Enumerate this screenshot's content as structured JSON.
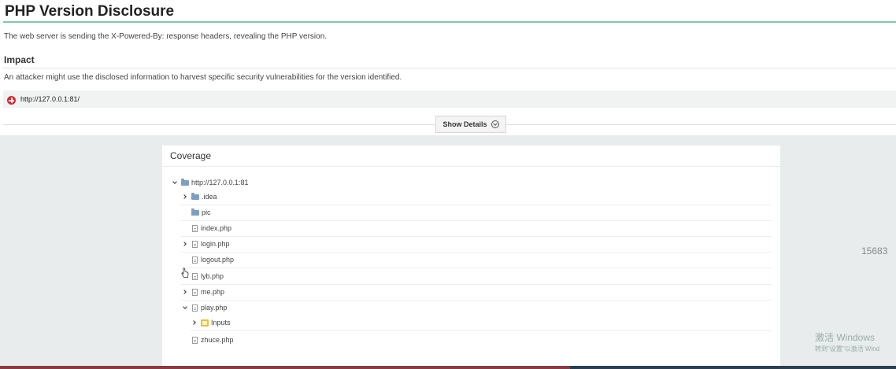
{
  "header": {
    "title": "PHP Version Disclosure",
    "description": "The web server is sending the X-Powered-By: response headers, revealing the PHP version."
  },
  "impact": {
    "heading": "Impact",
    "text": "An attacker might use the disclosed information to harvest specific security vulnerabilities for the version identified."
  },
  "affected": {
    "url": "http://127.0.0.1:81/"
  },
  "details_button": {
    "label": "Show Details"
  },
  "coverage": {
    "title": "Coverage",
    "root": "http://127.0.0.1:81",
    "items": [
      {
        "label": ".idea",
        "icon": "folder-icon",
        "expander": "right"
      },
      {
        "label": "pic",
        "icon": "folder-icon",
        "expander": "none"
      },
      {
        "label": "index.php",
        "icon": "file-icon",
        "expander": "none"
      },
      {
        "label": "login.php",
        "icon": "file-icon",
        "expander": "right"
      },
      {
        "label": "logout.php",
        "icon": "file-icon",
        "expander": "none"
      },
      {
        "label": "lyb.php",
        "icon": "file-icon",
        "expander": "none"
      },
      {
        "label": "me.php",
        "icon": "file-icon",
        "expander": "right"
      },
      {
        "label": "play.php",
        "icon": "file-icon",
        "expander": "down"
      },
      {
        "label": "Inputs",
        "icon": "inputs-icon",
        "expander": "right"
      },
      {
        "label": "zhuce.php",
        "icon": "file-icon",
        "expander": "none"
      }
    ]
  },
  "side_number": "15683",
  "watermark": {
    "line1": "激活 Windows",
    "line2": "转到\"设置\"以激活 Wind"
  },
  "colors": {
    "accent_rule": "#7fc6a6",
    "severity_red": "#d9282f",
    "folder_blue": "#7d9fbf"
  }
}
